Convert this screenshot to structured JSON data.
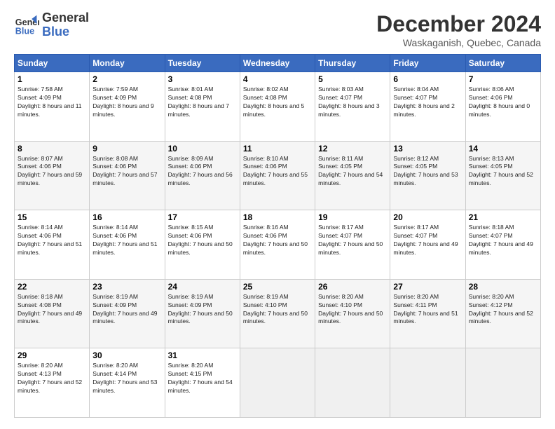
{
  "header": {
    "logo_line1": "General",
    "logo_line2": "Blue",
    "title": "December 2024",
    "subtitle": "Waskaganish, Quebec, Canada"
  },
  "days_of_week": [
    "Sunday",
    "Monday",
    "Tuesday",
    "Wednesday",
    "Thursday",
    "Friday",
    "Saturday"
  ],
  "weeks": [
    [
      {
        "day": "1",
        "rise": "7:58 AM",
        "set": "4:09 PM",
        "daylight": "8 hours and 11 minutes."
      },
      {
        "day": "2",
        "rise": "7:59 AM",
        "set": "4:09 PM",
        "daylight": "8 hours and 9 minutes."
      },
      {
        "day": "3",
        "rise": "8:01 AM",
        "set": "4:08 PM",
        "daylight": "8 hours and 7 minutes."
      },
      {
        "day": "4",
        "rise": "8:02 AM",
        "set": "4:08 PM",
        "daylight": "8 hours and 5 minutes."
      },
      {
        "day": "5",
        "rise": "8:03 AM",
        "set": "4:07 PM",
        "daylight": "8 hours and 3 minutes."
      },
      {
        "day": "6",
        "rise": "8:04 AM",
        "set": "4:07 PM",
        "daylight": "8 hours and 2 minutes."
      },
      {
        "day": "7",
        "rise": "8:06 AM",
        "set": "4:06 PM",
        "daylight": "8 hours and 0 minutes."
      }
    ],
    [
      {
        "day": "8",
        "rise": "8:07 AM",
        "set": "4:06 PM",
        "daylight": "7 hours and 59 minutes."
      },
      {
        "day": "9",
        "rise": "8:08 AM",
        "set": "4:06 PM",
        "daylight": "7 hours and 57 minutes."
      },
      {
        "day": "10",
        "rise": "8:09 AM",
        "set": "4:06 PM",
        "daylight": "7 hours and 56 minutes."
      },
      {
        "day": "11",
        "rise": "8:10 AM",
        "set": "4:06 PM",
        "daylight": "7 hours and 55 minutes."
      },
      {
        "day": "12",
        "rise": "8:11 AM",
        "set": "4:05 PM",
        "daylight": "7 hours and 54 minutes."
      },
      {
        "day": "13",
        "rise": "8:12 AM",
        "set": "4:05 PM",
        "daylight": "7 hours and 53 minutes."
      },
      {
        "day": "14",
        "rise": "8:13 AM",
        "set": "4:05 PM",
        "daylight": "7 hours and 52 minutes."
      }
    ],
    [
      {
        "day": "15",
        "rise": "8:14 AM",
        "set": "4:06 PM",
        "daylight": "7 hours and 51 minutes."
      },
      {
        "day": "16",
        "rise": "8:14 AM",
        "set": "4:06 PM",
        "daylight": "7 hours and 51 minutes."
      },
      {
        "day": "17",
        "rise": "8:15 AM",
        "set": "4:06 PM",
        "daylight": "7 hours and 50 minutes."
      },
      {
        "day": "18",
        "rise": "8:16 AM",
        "set": "4:06 PM",
        "daylight": "7 hours and 50 minutes."
      },
      {
        "day": "19",
        "rise": "8:17 AM",
        "set": "4:07 PM",
        "daylight": "7 hours and 50 minutes."
      },
      {
        "day": "20",
        "rise": "8:17 AM",
        "set": "4:07 PM",
        "daylight": "7 hours and 49 minutes."
      },
      {
        "day": "21",
        "rise": "8:18 AM",
        "set": "4:07 PM",
        "daylight": "7 hours and 49 minutes."
      }
    ],
    [
      {
        "day": "22",
        "rise": "8:18 AM",
        "set": "4:08 PM",
        "daylight": "7 hours and 49 minutes."
      },
      {
        "day": "23",
        "rise": "8:19 AM",
        "set": "4:09 PM",
        "daylight": "7 hours and 49 minutes."
      },
      {
        "day": "24",
        "rise": "8:19 AM",
        "set": "4:09 PM",
        "daylight": "7 hours and 50 minutes."
      },
      {
        "day": "25",
        "rise": "8:19 AM",
        "set": "4:10 PM",
        "daylight": "7 hours and 50 minutes."
      },
      {
        "day": "26",
        "rise": "8:20 AM",
        "set": "4:10 PM",
        "daylight": "7 hours and 50 minutes."
      },
      {
        "day": "27",
        "rise": "8:20 AM",
        "set": "4:11 PM",
        "daylight": "7 hours and 51 minutes."
      },
      {
        "day": "28",
        "rise": "8:20 AM",
        "set": "4:12 PM",
        "daylight": "7 hours and 52 minutes."
      }
    ],
    [
      {
        "day": "29",
        "rise": "8:20 AM",
        "set": "4:13 PM",
        "daylight": "7 hours and 52 minutes."
      },
      {
        "day": "30",
        "rise": "8:20 AM",
        "set": "4:14 PM",
        "daylight": "7 hours and 53 minutes."
      },
      {
        "day": "31",
        "rise": "8:20 AM",
        "set": "4:15 PM",
        "daylight": "7 hours and 54 minutes."
      },
      null,
      null,
      null,
      null
    ]
  ]
}
